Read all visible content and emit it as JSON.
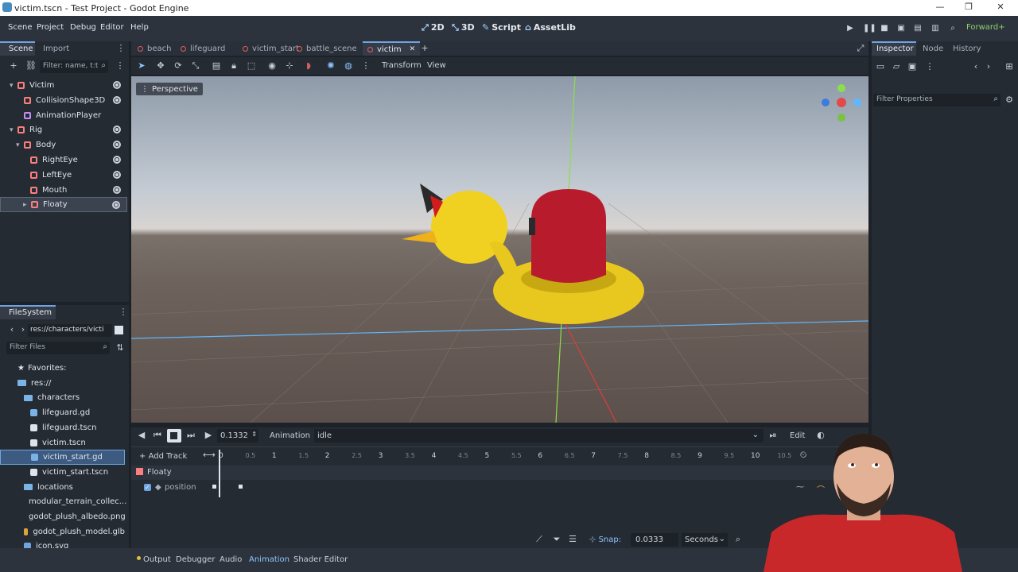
{
  "window": {
    "title": "victim.tscn - Test Project - Godot Engine"
  },
  "menu": [
    "Scene",
    "Project",
    "Debug",
    "Editor",
    "Help"
  ],
  "workspaces": [
    {
      "icon": "2d-icon",
      "label": "2D"
    },
    {
      "icon": "3d-icon",
      "label": "3D"
    },
    {
      "icon": "script-icon",
      "label": "Script"
    },
    {
      "icon": "assetlib-icon",
      "label": "AssetLib"
    }
  ],
  "renderer": "Forward+",
  "scene_dock": {
    "tabs": [
      "Scene",
      "Import"
    ],
    "filter_placeholder": "Filter: name, t:t",
    "nodes": [
      {
        "name": "Victim",
        "color": "#fc7f7f",
        "depth": 0,
        "arrow": "▾"
      },
      {
        "name": "CollisionShape3D",
        "color": "#fc7f7f",
        "depth": 1,
        "arrow": ""
      },
      {
        "name": "AnimationPlayer",
        "color": "#c38ef1",
        "depth": 1,
        "arrow": ""
      },
      {
        "name": "Rig",
        "color": "#fc7f7f",
        "depth": 0,
        "arrow": "▾"
      },
      {
        "name": "Body",
        "color": "#fc7f7f",
        "depth": 1,
        "arrow": "▾"
      },
      {
        "name": "RightEye",
        "color": "#fc7f7f",
        "depth": 2,
        "arrow": ""
      },
      {
        "name": "LeftEye",
        "color": "#fc7f7f",
        "depth": 2,
        "arrow": ""
      },
      {
        "name": "Mouth",
        "color": "#fc7f7f",
        "depth": 2,
        "arrow": ""
      },
      {
        "name": "Floaty",
        "color": "#fc7f7f",
        "depth": 2,
        "arrow": "▸"
      }
    ],
    "selected": "Floaty"
  },
  "filesystem": {
    "title": "FileSystem",
    "path": "res://characters/victi",
    "filter_placeholder": "Filter Files",
    "items": [
      {
        "name": "Favorites:",
        "type": "fav",
        "depth": 0
      },
      {
        "name": "res://",
        "type": "folder",
        "depth": 0
      },
      {
        "name": "characters",
        "type": "folder",
        "depth": 1
      },
      {
        "name": "lifeguard.gd",
        "type": "gd",
        "depth": 2
      },
      {
        "name": "lifeguard.tscn",
        "type": "tscn",
        "depth": 2
      },
      {
        "name": "victim.tscn",
        "type": "tscn",
        "depth": 2
      },
      {
        "name": "victim_start.gd",
        "type": "gd",
        "depth": 2
      },
      {
        "name": "victim_start.tscn",
        "type": "tscn",
        "depth": 2
      },
      {
        "name": "locations",
        "type": "folder",
        "depth": 1
      },
      {
        "name": "modular_terrain_collec...",
        "type": "folder",
        "depth": 1
      },
      {
        "name": "godot_plush_albedo.png",
        "type": "png",
        "depth": 1
      },
      {
        "name": "godot_plush_model.glb",
        "type": "glb",
        "depth": 1
      },
      {
        "name": "icon.svg",
        "type": "svg",
        "depth": 1
      }
    ],
    "selected": "victim_start.gd"
  },
  "scene_tabs": [
    "beach",
    "lifeguard",
    "victim_start",
    "battle_scene",
    "victim"
  ],
  "active_scene_tab": "victim",
  "viewport_toolbar": {
    "transform": "Transform",
    "view": "View"
  },
  "viewport": {
    "perspective_label": "Perspective"
  },
  "inspector": {
    "tabs": [
      "Inspector",
      "Node",
      "History"
    ],
    "filter_placeholder": "Filter Properties"
  },
  "animation": {
    "time": "0.1332",
    "label": "Animation",
    "current": "idle",
    "edit": "Edit",
    "add_track": "Add Track",
    "track_name": "Floaty",
    "property": "position",
    "ticks": [
      {
        "label": "0",
        "value": 0,
        "minor": false
      },
      {
        "label": "0.5",
        "value": 0.5,
        "minor": true
      },
      {
        "label": "1",
        "value": 1,
        "minor": false
      },
      {
        "label": "1.5",
        "value": 1.5,
        "minor": true
      },
      {
        "label": "2",
        "value": 2,
        "minor": false
      },
      {
        "label": "2.5",
        "value": 2.5,
        "minor": true
      },
      {
        "label": "3",
        "value": 3,
        "minor": false
      },
      {
        "label": "3.5",
        "value": 3.5,
        "minor": true
      },
      {
        "label": "4",
        "value": 4,
        "minor": false
      },
      {
        "label": "4.5",
        "value": 4.5,
        "minor": true
      },
      {
        "label": "5",
        "value": 5,
        "minor": false
      },
      {
        "label": "5.5",
        "value": 5.5,
        "minor": true
      },
      {
        "label": "6",
        "value": 6,
        "minor": false
      },
      {
        "label": "6.5",
        "value": 6.5,
        "minor": true
      },
      {
        "label": "7",
        "value": 7,
        "minor": false
      },
      {
        "label": "7.5",
        "value": 7.5,
        "minor": true
      },
      {
        "label": "8",
        "value": 8,
        "minor": false
      },
      {
        "label": "8.5",
        "value": 8.5,
        "minor": true
      },
      {
        "label": "9",
        "value": 9,
        "minor": false
      },
      {
        "label": "9.5",
        "value": 9.5,
        "minor": true
      },
      {
        "label": "10",
        "value": 10,
        "minor": false
      },
      {
        "label": "10.5",
        "value": 10.5,
        "minor": true
      }
    ],
    "snap_label": "Snap:",
    "snap_value": "0.0333",
    "unit": "Seconds"
  },
  "bottom_tabs": [
    "Output",
    "Debugger",
    "Audio",
    "Animation",
    "Shader Editor"
  ],
  "active_bottom_tab": "Animation"
}
